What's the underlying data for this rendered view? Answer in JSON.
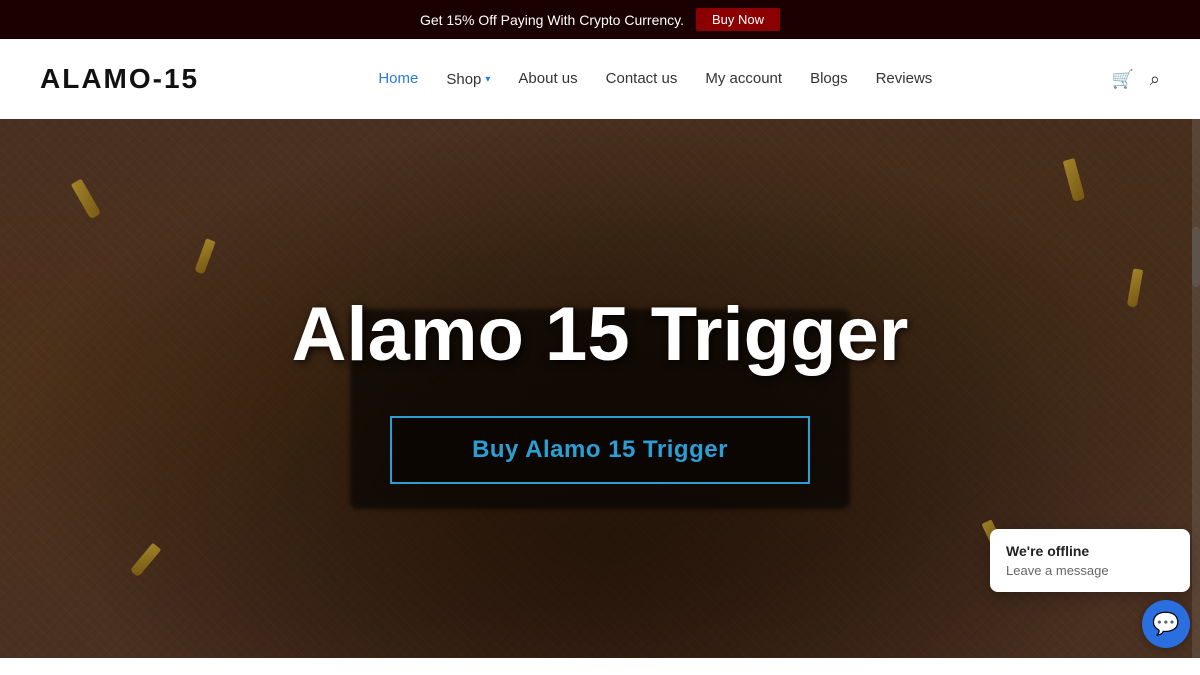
{
  "banner": {
    "text": "Get 15% Off Paying With Crypto Currency.",
    "buy_now_label": "Buy Now"
  },
  "navbar": {
    "logo": "ALAMO-15",
    "nav_items": [
      {
        "label": "Home",
        "active": true
      },
      {
        "label": "Shop",
        "has_dropdown": true
      },
      {
        "label": "About us",
        "active": false
      },
      {
        "label": "Contact us",
        "active": false
      },
      {
        "label": "My account",
        "active": false
      },
      {
        "label": "Blogs",
        "active": false
      },
      {
        "label": "Reviews",
        "active": false
      }
    ],
    "cart_icon": "🛒",
    "search_icon": "🔍"
  },
  "hero": {
    "title": "Alamo 15 Trigger",
    "cta_label": "Buy Alamo 15 Trigger"
  },
  "chat": {
    "status": "We're offline",
    "subtitle": "Leave a message",
    "icon": "💬"
  }
}
